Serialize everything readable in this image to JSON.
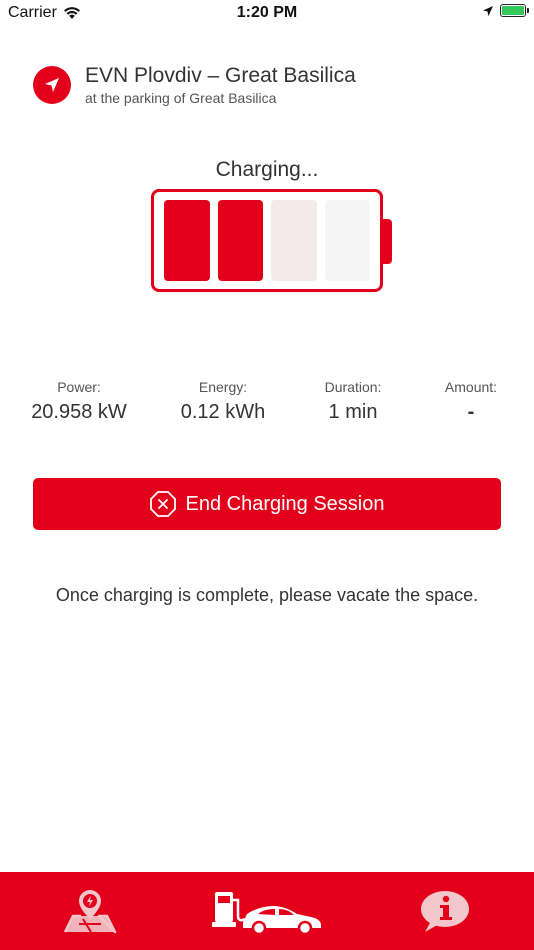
{
  "status_bar": {
    "carrier": "Carrier",
    "time": "1:20 PM"
  },
  "station": {
    "name": "EVN Plovdiv – Great Basilica",
    "subtitle": "at the parking of Great Basilica"
  },
  "charging": {
    "status_label": "Charging...",
    "level_cells_filled": 2,
    "level_cells_total": 4
  },
  "stats": [
    {
      "label": "Power:",
      "value": "20.958 kW"
    },
    {
      "label": "Energy:",
      "value": "0.12 kWh"
    },
    {
      "label": "Duration:",
      "value": "1 min"
    },
    {
      "label": "Amount:",
      "value": "-"
    }
  ],
  "end_button_label": "End Charging Session",
  "notice": "Once charging is complete, please vacate the space.",
  "tabs": [
    {
      "name": "map-tab",
      "icon": "map-charging-icon"
    },
    {
      "name": "charging-tab",
      "icon": "charger-car-icon"
    },
    {
      "name": "info-tab",
      "icon": "info-bubble-icon"
    }
  ],
  "colors": {
    "accent": "#e2001a",
    "battery_green": "#34c759"
  }
}
